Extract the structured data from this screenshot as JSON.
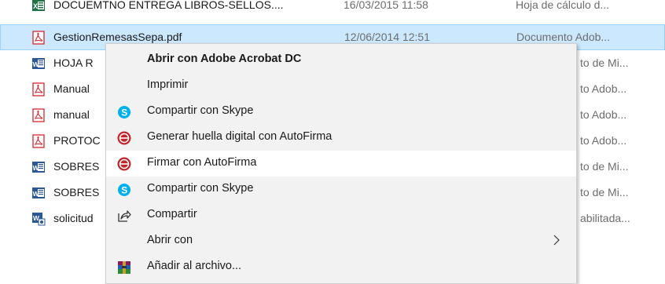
{
  "files": [
    {
      "name": "DOCUEMTNO ENTREGA LIBROS-SELLOS....",
      "date": "16/03/2015 11:58",
      "type": "Hoja de cálculo d...",
      "icon": "excel-icon"
    },
    {
      "name": "GestionRemesasSepa.pdf",
      "date": "12/06/2014 12:51",
      "type": "Documento Adob...",
      "icon": "pdf-icon",
      "selected": true
    },
    {
      "name": "HOJA R",
      "type_fragment": "to de Mi...",
      "icon": "word-icon"
    },
    {
      "name": "Manual",
      "type_fragment": "to Adob...",
      "icon": "pdf-icon"
    },
    {
      "name": "manual",
      "type_fragment": "to Adob...",
      "icon": "pdf-icon"
    },
    {
      "name": "PROTOC",
      "type_fragment": "to Adob...",
      "icon": "pdf-icon"
    },
    {
      "name": "SOBRES",
      "type_fragment": "to de Mi...",
      "icon": "word-icon"
    },
    {
      "name": "SOBRES",
      "type_fragment": "to de Mi...",
      "icon": "word-icon"
    },
    {
      "name": "solicitud",
      "type_fragment": "abilitada...",
      "icon": "word-macro-icon"
    }
  ],
  "context_menu": {
    "items": [
      {
        "label": "Abrir con Adobe Acrobat DC",
        "bold": true,
        "icon": ""
      },
      {
        "label": "Imprimir",
        "icon": ""
      },
      {
        "label": "Compartir con Skype",
        "icon": "skype-icon"
      },
      {
        "label": "Generar huella digital con AutoFirma",
        "icon": "autofirma-icon"
      },
      {
        "label": "Firmar con AutoFirma",
        "icon": "autofirma-icon",
        "highlighted": true
      },
      {
        "label": "Compartir con Skype",
        "icon": "skype-icon"
      },
      {
        "label": "Compartir",
        "icon": "share-icon"
      },
      {
        "label": "Abrir con",
        "icon": "",
        "submenu": true
      },
      {
        "label": "Añadir al archivo...",
        "icon": "winrar-icon"
      }
    ]
  },
  "colors": {
    "selection": "#cce8ff",
    "selection_border": "#99d1ff",
    "menu_bg": "#f2f2f2",
    "pdf_red": "#d7262c",
    "word_blue": "#2b5797",
    "skype_blue": "#00aff0",
    "autofirma_red": "#c0272d"
  }
}
